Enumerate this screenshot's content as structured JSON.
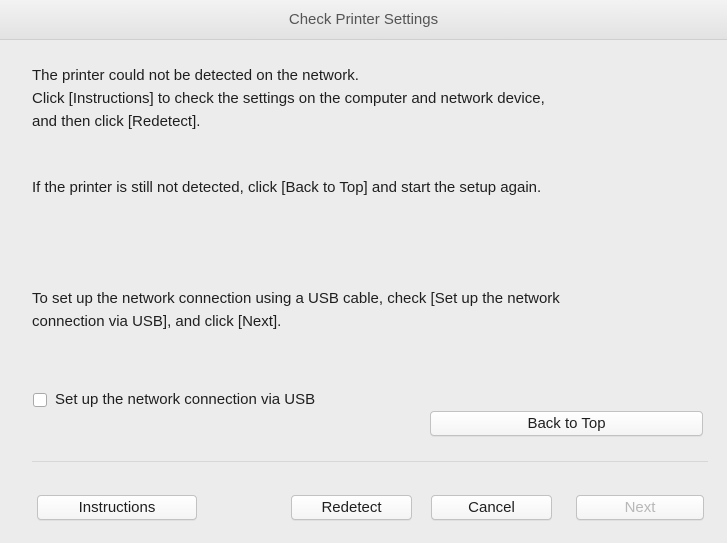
{
  "window": {
    "title": "Check Printer Settings"
  },
  "messages": {
    "not_detected_lines": [
      "The printer could not be detected on the network.",
      "Click [Instructions] to check the settings on the computer and network device,",
      "and then click [Redetect]."
    ],
    "still_not_detected": "If the printer is still not detected, click [Back to Top] and start the setup again.",
    "usb_lines": [
      "To set up the network connection using a USB cable, check [Set up the network",
      "connection via USB], and click [Next]."
    ]
  },
  "usb_option": {
    "label": "Set up the network connection via USB",
    "checked": false
  },
  "buttons": {
    "back_to_top": "Back to Top",
    "instructions": "Instructions",
    "redetect": "Redetect",
    "cancel": "Cancel",
    "next": "Next",
    "next_enabled": false
  }
}
